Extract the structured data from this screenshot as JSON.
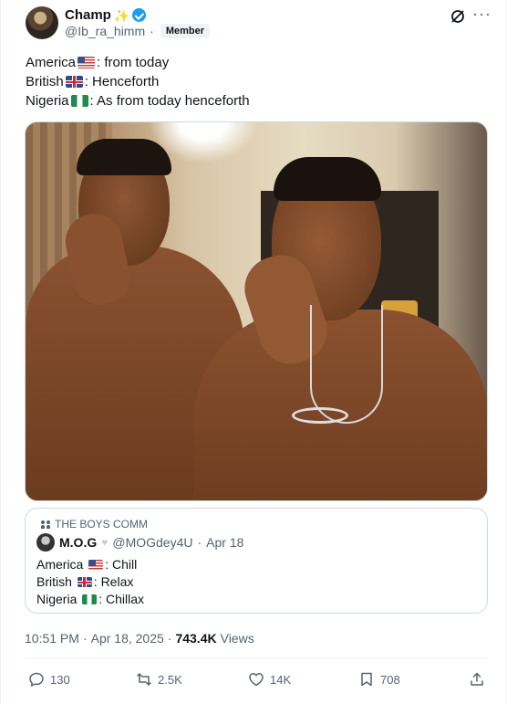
{
  "author": {
    "name": "Champ",
    "handle": "@Ib_ra_himm",
    "separator": "·",
    "badge": "Member",
    "sparkle": "✨"
  },
  "tweet": {
    "lines": [
      {
        "prefix": "America",
        "flag": "us",
        "suffix": ": from today"
      },
      {
        "prefix": "British",
        "flag": "uk",
        "suffix": ": Henceforth"
      },
      {
        "prefix": "Nigeria",
        "flag": "ng",
        "suffix": ": As from today henceforth"
      }
    ]
  },
  "quoted": {
    "community": "THE BOYS COMM",
    "name": "M.O.G",
    "handle": "@MOGdey4U",
    "dot": "·",
    "date": "Apr 18",
    "lines": [
      {
        "prefix": "America ",
        "flag": "us",
        "suffix": ": Chill"
      },
      {
        "prefix": "British ",
        "flag": "uk",
        "suffix": ": Relax"
      },
      {
        "prefix": "Nigeria ",
        "flag": "ng",
        "suffix": ": Chillax"
      }
    ]
  },
  "meta": {
    "time": "10:51 PM",
    "dot1": "·",
    "date": "Apr 18, 2025",
    "dot2": "·",
    "views_count": "743.4K",
    "views_label": "Views"
  },
  "actions": {
    "replies": "130",
    "reposts": "2.5K",
    "likes": "14K",
    "bookmarks": "708"
  },
  "colors": {
    "verified": "#1d9bf0",
    "text": "#0f1419",
    "secondary": "#536471",
    "border": "#cfd9de"
  },
  "icons": [
    "verified-icon",
    "grok-icon",
    "more-icon",
    "community-icon",
    "reply-icon",
    "repost-icon",
    "like-icon",
    "bookmark-icon",
    "share-icon"
  ]
}
